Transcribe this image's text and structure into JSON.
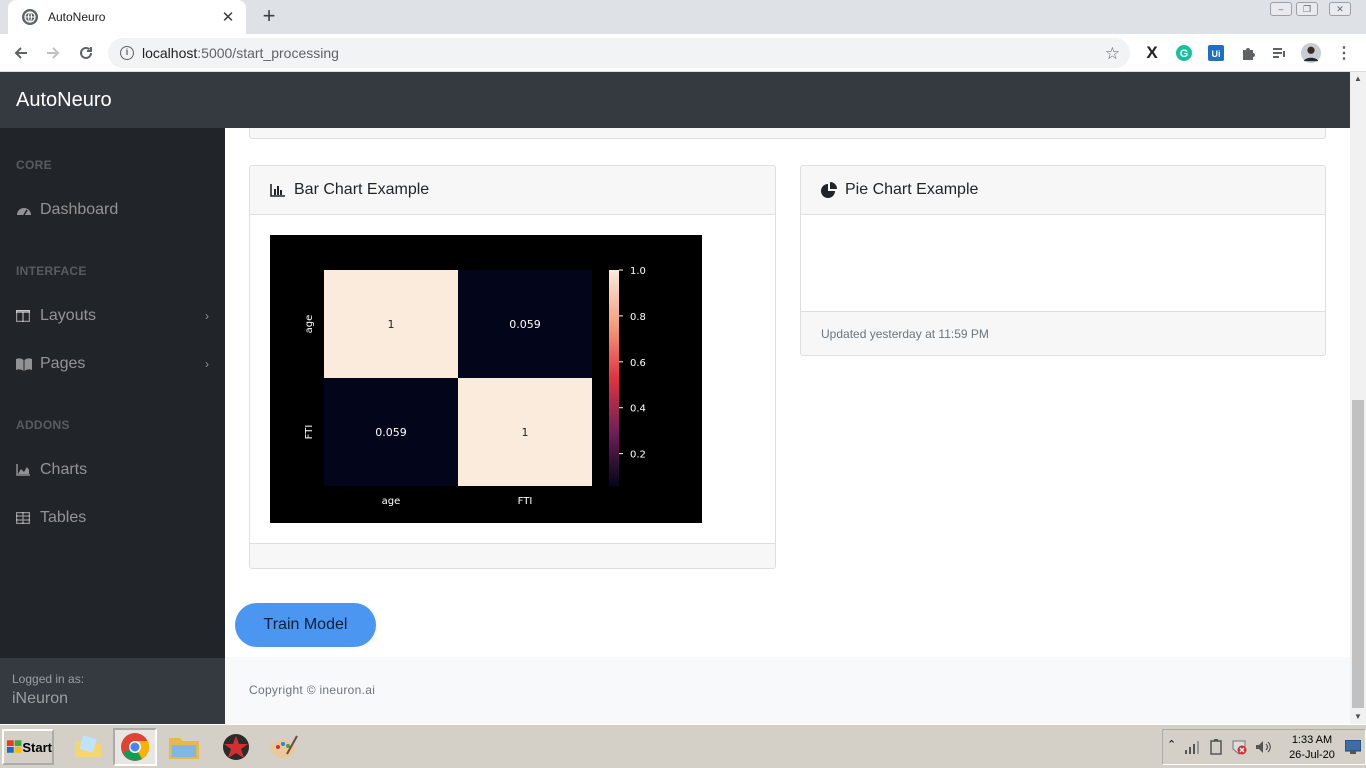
{
  "browser": {
    "tab_title": "AutoNeuro",
    "tab_close": "✕",
    "new_tab": "+",
    "url_host": "localhost",
    "url_path": ":5000/start_processing",
    "star": "☆"
  },
  "app": {
    "brand": "AutoNeuro"
  },
  "sidebar": {
    "sections": [
      {
        "heading": "CORE"
      },
      {
        "heading": "INTERFACE"
      },
      {
        "heading": "ADDONS"
      }
    ],
    "items": [
      {
        "label": "Dashboard",
        "icon": "tachometer-icon"
      },
      {
        "label": "Layouts",
        "icon": "columns-icon",
        "chevron": "›"
      },
      {
        "label": "Pages",
        "icon": "book-icon",
        "chevron": "›"
      },
      {
        "label": "Charts",
        "icon": "area-chart-icon"
      },
      {
        "label": "Tables",
        "icon": "table-icon"
      }
    ],
    "footer": {
      "caption": "Logged in as:",
      "user": "iNeuron"
    }
  },
  "cards": {
    "bar": {
      "title": "Bar Chart Example"
    },
    "pie": {
      "title": "Pie Chart Example",
      "footer": "Updated yesterday at 11:59 PM"
    }
  },
  "train_button": "Train Model",
  "footer": {
    "copyright": "Copyright © ineuron.ai"
  },
  "taskbar": {
    "start": "Start",
    "time": "1:33 AM",
    "date": "26-Jul-20"
  },
  "chart_data": {
    "type": "heatmap",
    "x_categories": [
      "age",
      "FTI"
    ],
    "y_categories": [
      "age",
      "FTI"
    ],
    "values": [
      [
        1,
        0.059
      ],
      [
        0.059,
        1
      ]
    ],
    "cell_labels": [
      [
        "1",
        "0.059"
      ],
      [
        "0.059",
        "1"
      ]
    ],
    "colorbar": {
      "ticks": [
        "1.0",
        "0.8",
        "0.6",
        "0.4",
        "0.2"
      ],
      "range": [
        0.059,
        1.0
      ]
    },
    "colors": {
      "high": "#faebdd",
      "low": "#03051a",
      "background": "#000000"
    }
  }
}
